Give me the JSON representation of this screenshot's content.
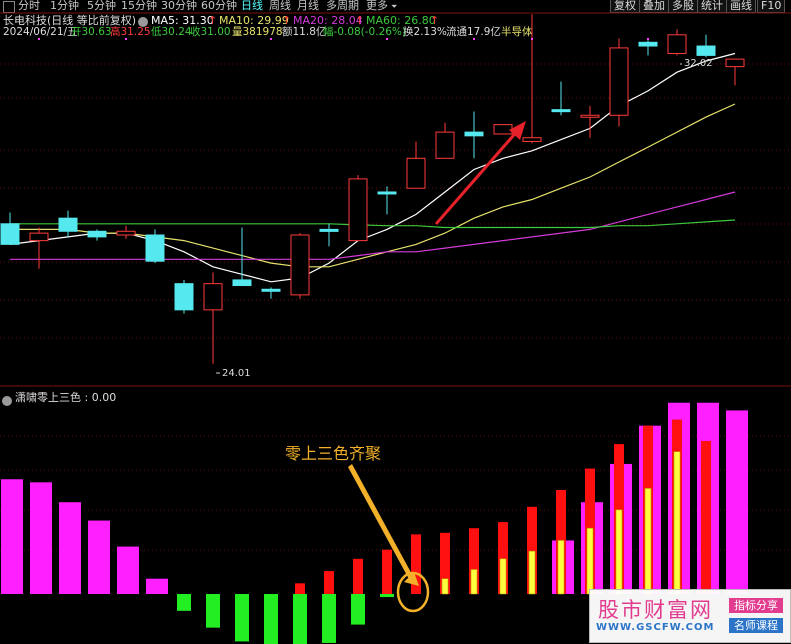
{
  "toolbar": {
    "periods": [
      "分时",
      "1分钟",
      "5分钟",
      "15分钟",
      "30分钟",
      "60分钟",
      "日线",
      "周线",
      "月线",
      "多周期",
      "更多"
    ],
    "active_period": "日线",
    "buttons": [
      "复权",
      "叠加",
      "多股",
      "统计",
      "画线",
      "F10"
    ]
  },
  "header": {
    "stock_title": "长电科技(日线 等比前复权)",
    "ma5_label": "MA5: 31.30",
    "ma10_label": "MA10: 29.99",
    "ma20_label": "MA20: 28.04",
    "ma60_label": "MA60: 26.80",
    "up_arrow": "↑"
  },
  "quote": {
    "date": "2024/06/21/五",
    "open_label": "开30.63",
    "high_label": "高31.25",
    "low_label": "低30.24",
    "close_label": "收31.00",
    "volume_label": "量381978",
    "amount_label": "额11.8亿",
    "change_label": "幅-0.08(-0.26%)",
    "turnover_label": "换2.13%",
    "float_label": "流通17.9亿",
    "sector_label": "半导体"
  },
  "price_chart": {
    "high_annotation": "32.02",
    "low_annotation": "24.01"
  },
  "indicator": {
    "title": "潇啸零上三色 : 0.00",
    "annotation": "零上三色齐聚"
  },
  "watermark": {
    "title": "股市财富网",
    "url": "WWW.GSCFW.COM",
    "tag1": "指标分享",
    "tag2": "名师课程"
  },
  "colors": {
    "up": "#ff3b3b",
    "down": "#55e8ee",
    "ma5": "#ffffff",
    "ma10": "#e6e26b",
    "ma20": "#d23bd8",
    "ma60": "#3cc93c",
    "magenta_bar": "#ff1fff",
    "green_bar": "#22ee22",
    "red_bar": "#ff1010",
    "yellow_bar": "#ffff40",
    "annotation": "#f2b128"
  },
  "chart_data": [
    {
      "type": "candlestick",
      "series": [
        {
          "o": 27.75,
          "h": 28.05,
          "l": 27.2,
          "c": 27.2
        },
        {
          "o": 27.3,
          "h": 27.65,
          "l": 26.55,
          "c": 27.5
        },
        {
          "o": 27.9,
          "h": 28.1,
          "l": 27.4,
          "c": 27.55
        },
        {
          "o": 27.55,
          "h": 27.6,
          "l": 27.3,
          "c": 27.4
        },
        {
          "o": 27.45,
          "h": 27.7,
          "l": 27.35,
          "c": 27.55
        },
        {
          "o": 27.45,
          "h": 27.6,
          "l": 26.7,
          "c": 26.75
        },
        {
          "o": 26.15,
          "h": 26.25,
          "l": 25.35,
          "c": 25.45
        },
        {
          "o": 25.45,
          "h": 26.45,
          "l": 24.01,
          "c": 26.15
        },
        {
          "o": 26.25,
          "h": 27.65,
          "l": 26.1,
          "c": 26.1
        },
        {
          "o": 26.0,
          "h": 26.05,
          "l": 25.75,
          "c": 25.95
        },
        {
          "o": 25.85,
          "h": 27.5,
          "l": 25.75,
          "c": 27.45
        },
        {
          "o": 27.6,
          "h": 27.75,
          "l": 27.15,
          "c": 27.55
        },
        {
          "o": 27.3,
          "h": 29.05,
          "l": 27.3,
          "c": 28.95
        },
        {
          "o": 28.6,
          "h": 28.75,
          "l": 28.0,
          "c": 28.55
        },
        {
          "o": 28.7,
          "h": 29.95,
          "l": 28.7,
          "c": 29.5
        },
        {
          "o": 29.5,
          "h": 30.45,
          "l": 29.5,
          "c": 30.2
        },
        {
          "o": 30.2,
          "h": 30.75,
          "l": 29.5,
          "c": 30.1
        },
        {
          "o": 30.15,
          "h": 30.4,
          "l": 30.4,
          "c": 30.4
        },
        {
          "o": 29.95,
          "h": 33.35,
          "l": 29.9,
          "c": 30.05
        },
        {
          "o": 30.8,
          "h": 31.55,
          "l": 30.65,
          "c": 30.75
        },
        {
          "o": 30.65,
          "h": 30.9,
          "l": 30.05,
          "c": 30.65
        },
        {
          "o": 30.65,
          "h": 32.7,
          "l": 30.35,
          "c": 32.45
        },
        {
          "o": 32.6,
          "h": 32.65,
          "l": 32.25,
          "c": 32.5
        },
        {
          "o": 32.3,
          "h": 32.95,
          "l": 32.25,
          "c": 32.8
        },
        {
          "o": 32.5,
          "h": 32.8,
          "l": 32.2,
          "c": 32.25
        },
        {
          "o": 31.95,
          "h": 32.15,
          "l": 31.45,
          "c": 32.15
        }
      ],
      "ma_lines": [
        {
          "name": "MA5",
          "values": [
            27.2,
            27.3,
            27.4,
            27.5,
            27.5,
            27.3,
            27.0,
            26.6,
            26.4,
            26.2,
            26.3,
            26.7,
            27.3,
            27.6,
            28.0,
            28.6,
            29.2,
            29.5,
            29.7,
            30.0,
            30.3,
            30.9,
            31.3,
            31.8,
            32.1,
            32.3
          ]
        },
        {
          "name": "MA10",
          "values": [
            27.6,
            27.6,
            27.6,
            27.5,
            27.5,
            27.4,
            27.3,
            27.1,
            26.9,
            26.7,
            26.6,
            26.6,
            26.8,
            27.0,
            27.2,
            27.5,
            27.9,
            28.2,
            28.4,
            28.7,
            29.0,
            29.4,
            29.8,
            30.2,
            30.6,
            30.95
          ]
        },
        {
          "name": "MA20",
          "values": [
            26.8,
            26.8,
            26.8,
            26.8,
            26.8,
            26.8,
            26.8,
            26.8,
            26.8,
            26.8,
            26.8,
            26.8,
            26.9,
            27.0,
            27.0,
            27.1,
            27.2,
            27.3,
            27.4,
            27.5,
            27.6,
            27.8,
            28.0,
            28.2,
            28.4,
            28.6
          ]
        },
        {
          "name": "MA60",
          "values": [
            27.75,
            27.75,
            27.75,
            27.75,
            27.75,
            27.75,
            27.75,
            27.75,
            27.75,
            27.75,
            27.75,
            27.75,
            27.72,
            27.7,
            27.7,
            27.65,
            27.65,
            27.65,
            27.65,
            27.65,
            27.65,
            27.7,
            27.7,
            27.75,
            27.8,
            27.85
          ]
        }
      ]
    },
    {
      "type": "bar",
      "series": [
        {
          "name": "magenta",
          "values": [
            7.5,
            7.3,
            6.0,
            4.8,
            3.1,
            1.0,
            0,
            0,
            0,
            0,
            0,
            0,
            0,
            0,
            0,
            0,
            0,
            0,
            0,
            3.5,
            6.0,
            8.5,
            11.0,
            12.5,
            12.5,
            12.0
          ]
        },
        {
          "name": "green",
          "values": [
            0,
            0,
            0,
            0,
            0,
            0,
            -1.1,
            -2.2,
            -3.1,
            -3.6,
            -4.1,
            -3.2,
            -2.0,
            -0.2,
            0,
            0,
            0,
            0,
            0,
            0,
            0,
            0,
            0,
            0,
            0,
            0
          ]
        },
        {
          "name": "red",
          "values": [
            0,
            0,
            0,
            0,
            0,
            0,
            0,
            0,
            0,
            0,
            0.7,
            1.5,
            2.3,
            2.9,
            3.9,
            4.0,
            4.3,
            4.7,
            5.7,
            6.8,
            8.2,
            9.8,
            11.0,
            11.4,
            10.0,
            0
          ]
        },
        {
          "name": "yellow",
          "values": [
            0,
            0,
            0,
            0,
            0,
            0,
            0,
            0,
            0,
            0,
            0,
            0,
            0,
            0,
            0,
            1.0,
            1.6,
            2.3,
            2.8,
            3.5,
            4.3,
            5.5,
            6.9,
            9.3,
            0,
            0
          ]
        }
      ]
    }
  ]
}
